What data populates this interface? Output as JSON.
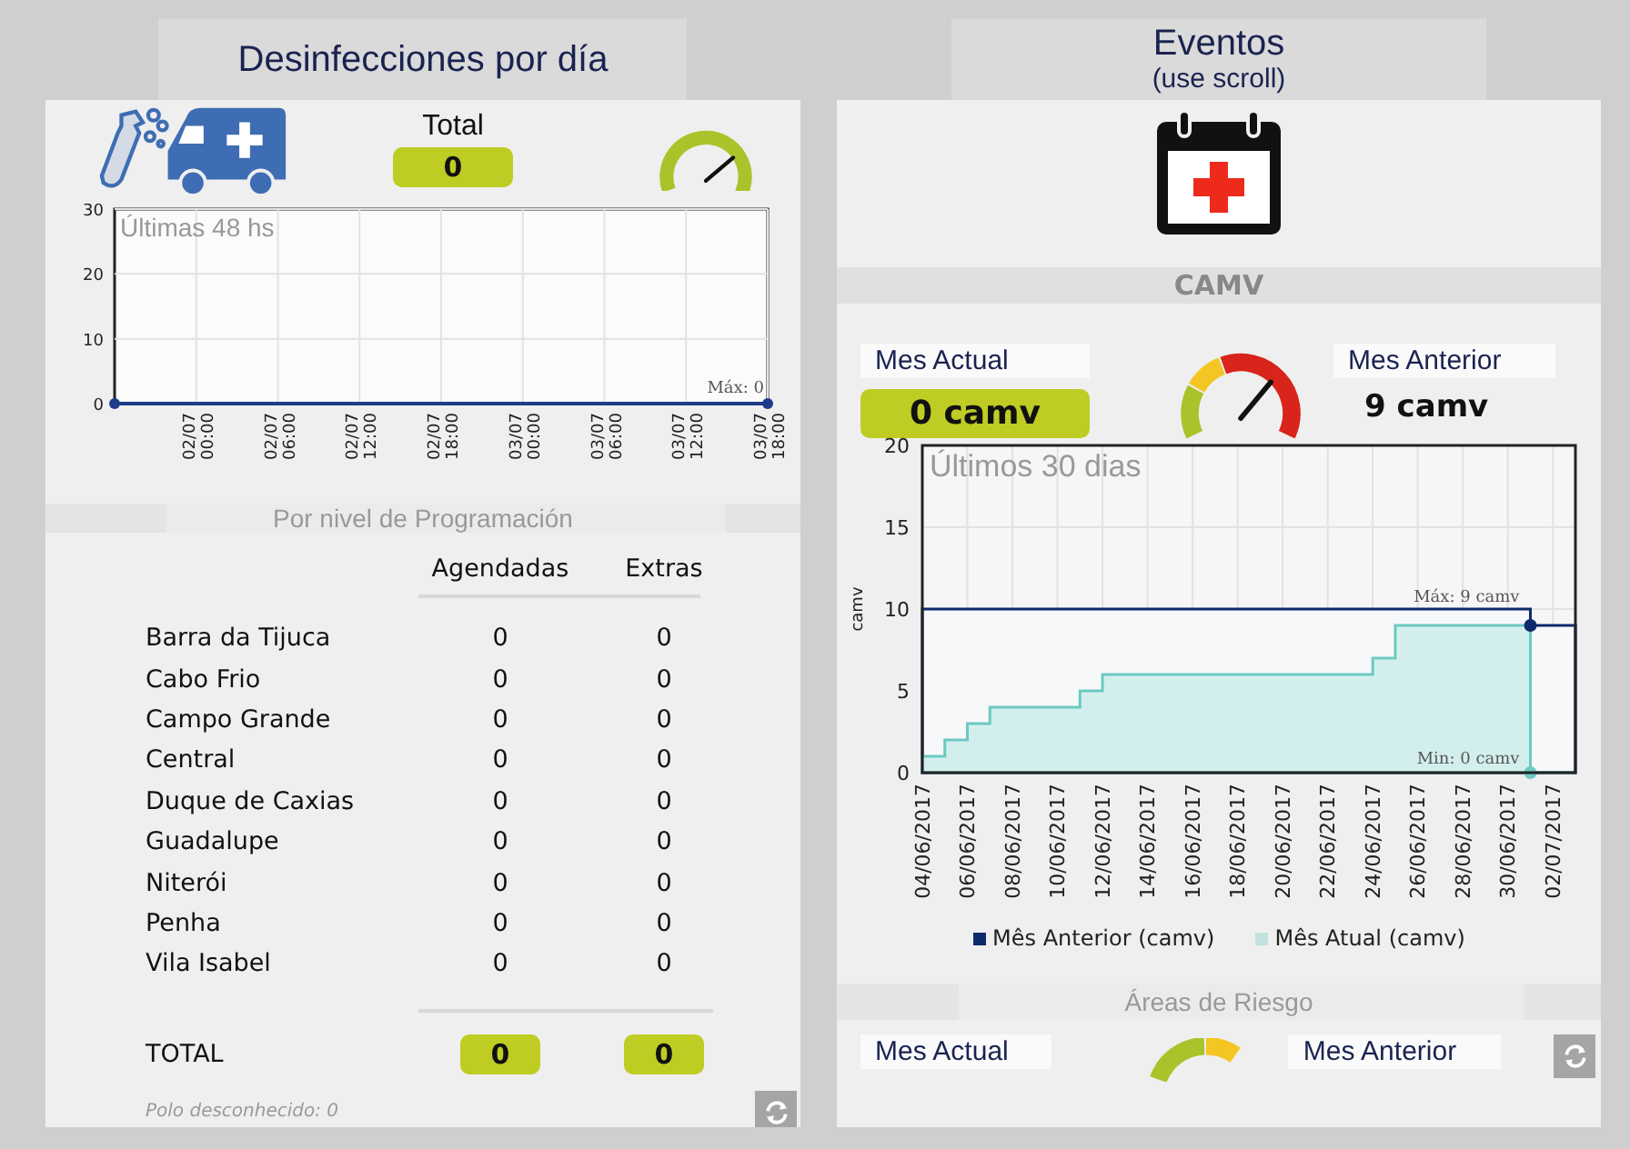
{
  "left_panel": {
    "title": "Desinfecciones por día",
    "total": {
      "label": "Total",
      "value": "0"
    },
    "gauge": {
      "level": 0.75
    },
    "chart_data": {
      "type": "line",
      "title": "Últimas 48 hs",
      "categories": [
        null,
        "02/07 00:00",
        "02/07 06:00",
        "02/07 12:00",
        "02/07 18:00",
        "03/07 00:00",
        "03/07 06:00",
        "03/07 12:00",
        "03/07 18:00"
      ],
      "ylim": [
        0,
        30
      ],
      "yticks": [
        0,
        10,
        20,
        30
      ],
      "grid": true,
      "series": [
        {
          "color": "#1f3c88",
          "values": [
            0,
            0,
            0,
            0,
            0,
            0,
            0,
            0,
            0
          ]
        }
      ],
      "annotations": [
        {
          "text": "Máx: 0"
        }
      ]
    },
    "section_title": "Por nivel de Programación",
    "table": {
      "columns": [
        "Agendadas",
        "Extras"
      ],
      "rows": [
        {
          "name": "Barra da Tijuca",
          "agendadas": "0",
          "extras": "0"
        },
        {
          "name": "Cabo Frio",
          "agendadas": "0",
          "extras": "0"
        },
        {
          "name": "Campo Grande",
          "agendadas": "0",
          "extras": "0"
        },
        {
          "name": "Central",
          "agendadas": "0",
          "extras": "0"
        },
        {
          "name": "Duque de Caxias",
          "agendadas": "0",
          "extras": "0"
        },
        {
          "name": "Guadalupe",
          "agendadas": "0",
          "extras": "0"
        },
        {
          "name": "Niterói",
          "agendadas": "0",
          "extras": "0"
        },
        {
          "name": "Penha",
          "agendadas": "0",
          "extras": "0"
        },
        {
          "name": "Vila Isabel",
          "agendadas": "0",
          "extras": "0"
        }
      ],
      "total": {
        "label": "TOTAL",
        "agendadas": "0",
        "extras": "0"
      }
    },
    "footnote": "Polo desconhecido: 0"
  },
  "right_panel": {
    "title": "Eventos",
    "subtitle": "(use scroll)",
    "section_title": "CAMV",
    "current": {
      "label": "Mes Actual",
      "value": "0 camv"
    },
    "gauge": {
      "level": 0.7
    },
    "previous": {
      "label": "Mes Anterior",
      "value": "9 camv"
    },
    "chart_data": {
      "type": "area",
      "title": "Últimos 30 dias",
      "ylabel": "camv",
      "categories": [
        "04/06/2017",
        null,
        "06/06/2017",
        null,
        "08/06/2017",
        null,
        "10/06/2017",
        null,
        "12/06/2017",
        null,
        "14/06/2017",
        null,
        "16/06/2017",
        null,
        "18/06/2017",
        null,
        "20/06/2017",
        null,
        "22/06/2017",
        null,
        "24/06/2017",
        null,
        "26/06/2017",
        null,
        "28/06/2017",
        null,
        "30/06/2017",
        null,
        "02/07/2017",
        null
      ],
      "ylim": [
        0,
        20
      ],
      "yticks": [
        0,
        5,
        10,
        15,
        20
      ],
      "grid": true,
      "legend": "bottom",
      "series": [
        {
          "name": "Mês Atual (camv)",
          "color": "#6cc9c2",
          "values": [
            1,
            2,
            3,
            4,
            4,
            4,
            4,
            5,
            6,
            6,
            6,
            6,
            6,
            6,
            6,
            6,
            6,
            6,
            6,
            6,
            7,
            9,
            9,
            9,
            9,
            9,
            9,
            0,
            0,
            0
          ]
        },
        {
          "name": "Mês Anterior (camv)",
          "color": "#0d2a6b",
          "values": [
            10,
            10,
            10,
            10,
            10,
            10,
            10,
            10,
            10,
            10,
            10,
            10,
            10,
            10,
            10,
            10,
            10,
            10,
            10,
            10,
            10,
            10,
            10,
            10,
            10,
            10,
            10,
            9,
            9,
            9
          ]
        }
      ],
      "annotations": [
        {
          "text": "Máx: 9 camv"
        },
        {
          "text": "Min: 0 camv"
        }
      ]
    },
    "next_section": {
      "title": "Áreas de Riesgo",
      "current_label": "Mes Actual",
      "previous_label": "Mes Anterior"
    }
  }
}
